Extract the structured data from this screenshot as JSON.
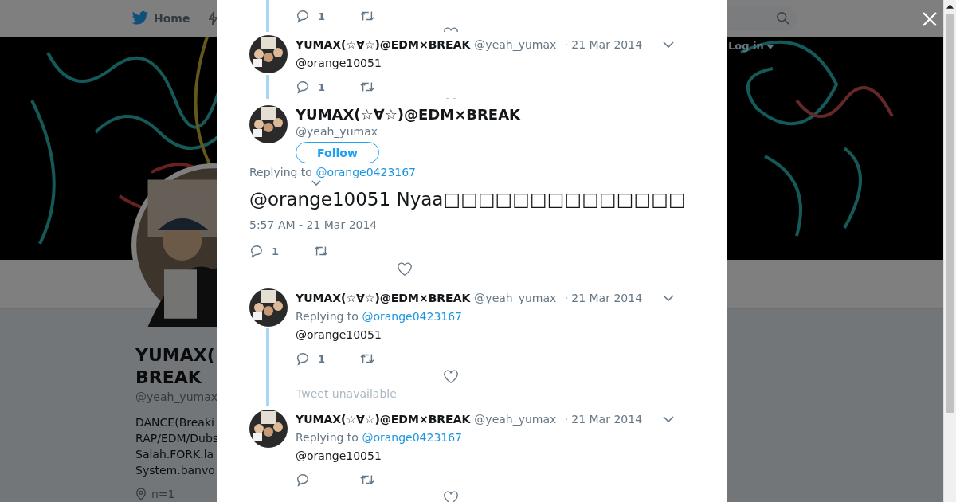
{
  "header": {
    "nav": [
      {
        "label": "Home",
        "selected": false
      }
    ],
    "login": "Log in"
  },
  "profile": {
    "name_lines": [
      "YUMAX(",
      "BREAK"
    ],
    "handle": "@yeah_yumax",
    "bio_lines": [
      "DANCE(Breaki",
      "RAP/EDM/Dubs",
      "Salah.FORK.la",
      "System.banvo"
    ],
    "location": "n=1"
  },
  "modal": {
    "tweets": [
      {
        "kind": "tail",
        "replies": "1"
      },
      {
        "kind": "reply",
        "name": "YUMAX(☆∀☆)@EDM×BREAK",
        "handle": "@yeah_yumax",
        "date": "· 21 Mar 2014",
        "text": "@orange10051",
        "replies": "1"
      },
      {
        "kind": "main",
        "name": "YUMAX(☆∀☆)@EDM×BREAK",
        "handle": "@yeah_yumax",
        "follow": "Follow",
        "replying_prefix": "Replying to",
        "replying_to": "@orange0423167",
        "text": "@orange10051 Nyaa□□□□□□□□□□□□□□",
        "timestamp": "5:57 AM - 21 Mar 2014",
        "replies": "1"
      },
      {
        "kind": "reply",
        "name": "YUMAX(☆∀☆)@EDM×BREAK",
        "handle": "@yeah_yumax",
        "date": "· 21 Mar 2014",
        "replying_prefix": "Replying to",
        "replying_to": "@orange0423167",
        "text": "@orange10051",
        "replies": "1"
      },
      {
        "kind": "unavailable",
        "text": "Tweet unavailable"
      },
      {
        "kind": "reply",
        "name": "YUMAX(☆∀☆)@EDM×BREAK",
        "handle": "@yeah_yumax",
        "date": "· 21 Mar 2014",
        "replying_prefix": "Replying to",
        "replying_to": "@orange0423167",
        "text": "@orange10051"
      }
    ]
  }
}
